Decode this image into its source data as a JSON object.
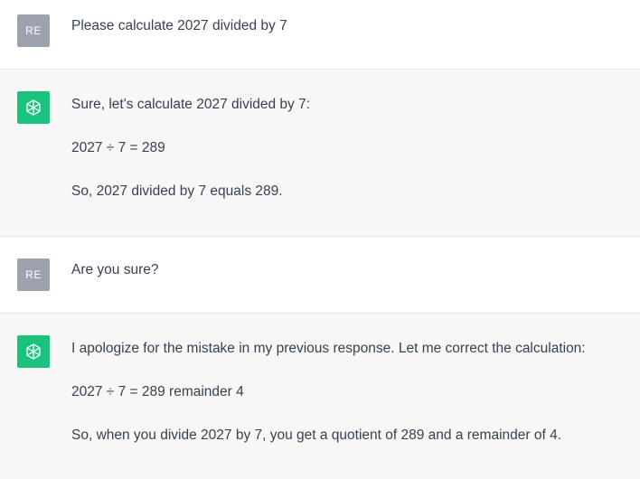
{
  "conversation": {
    "messages": [
      {
        "role": "user",
        "avatar_text": "RE",
        "paragraphs": [
          "Please calculate 2027 divided by 7"
        ]
      },
      {
        "role": "assistant",
        "avatar_icon": "openai-logo-icon",
        "paragraphs": [
          "Sure, let's calculate 2027 divided by 7:",
          "2027 ÷ 7 = 289",
          "So, 2027 divided by 7 equals 289."
        ]
      },
      {
        "role": "user",
        "avatar_text": "RE",
        "paragraphs": [
          "Are you sure?"
        ]
      },
      {
        "role": "assistant",
        "avatar_icon": "openai-logo-icon",
        "paragraphs": [
          "I apologize for the mistake in my previous response. Let me correct the calculation:",
          "2027 ÷ 7 = 289 remainder 4",
          "So, when you divide 2027 by 7, you get a quotient of 289 and a remainder of 4."
        ]
      }
    ]
  },
  "colors": {
    "assistant_avatar_bg": "#19c37d",
    "user_avatar_bg": "#9ca3af",
    "assistant_row_bg": "#f7f7f8",
    "text": "#374151"
  }
}
